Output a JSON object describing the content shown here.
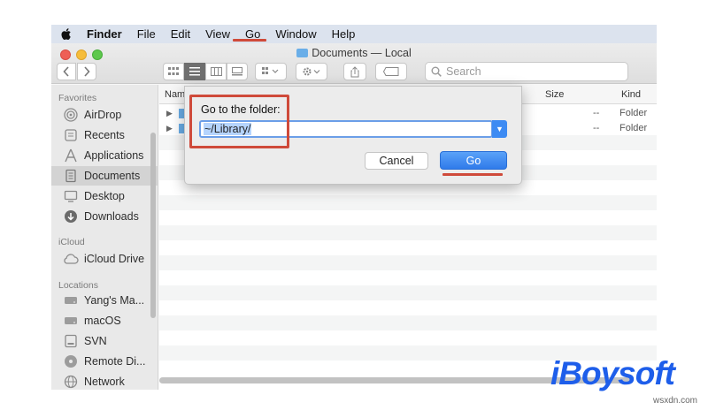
{
  "menubar": {
    "app": "Finder",
    "items": [
      "File",
      "Edit",
      "View",
      "Go",
      "Window",
      "Help"
    ]
  },
  "window": {
    "title": "Documents — Local",
    "search_placeholder": "Search"
  },
  "sidebar": {
    "favorites_header": "Favorites",
    "favorites": [
      {
        "label": "AirDrop",
        "icon": "airdrop-icon"
      },
      {
        "label": "Recents",
        "icon": "clock-icon"
      },
      {
        "label": "Applications",
        "icon": "applications-icon"
      },
      {
        "label": "Documents",
        "icon": "document-icon",
        "active": true
      },
      {
        "label": "Desktop",
        "icon": "desktop-icon"
      },
      {
        "label": "Downloads",
        "icon": "download-icon"
      }
    ],
    "icloud_header": "iCloud",
    "icloud": [
      {
        "label": "iCloud Drive",
        "icon": "cloud-icon"
      }
    ],
    "locations_header": "Locations",
    "locations": [
      {
        "label": "Yang's Ma...",
        "icon": "drive-icon"
      },
      {
        "label": "macOS",
        "icon": "drive-icon"
      },
      {
        "label": "SVN",
        "icon": "drive-icon"
      },
      {
        "label": "Remote Di...",
        "icon": "disc-icon"
      },
      {
        "label": "Network",
        "icon": "network-icon"
      }
    ]
  },
  "filelist": {
    "columns": {
      "name": "Name",
      "size": "Size",
      "kind": "Kind"
    },
    "rows": [
      {
        "size": "--",
        "kind": "Folder"
      },
      {
        "size": "--",
        "kind": "Folder"
      }
    ]
  },
  "dialog": {
    "label": "Go to the folder:",
    "value": "~/Library/",
    "cancel": "Cancel",
    "go": "Go"
  },
  "branding": {
    "logo": "iBoysoft",
    "watermark": "wsxdn.com"
  },
  "colors": {
    "annotation_red": "#cf4a3a",
    "accent_blue": "#3d8bf3",
    "brand_blue": "#1e5eea"
  }
}
